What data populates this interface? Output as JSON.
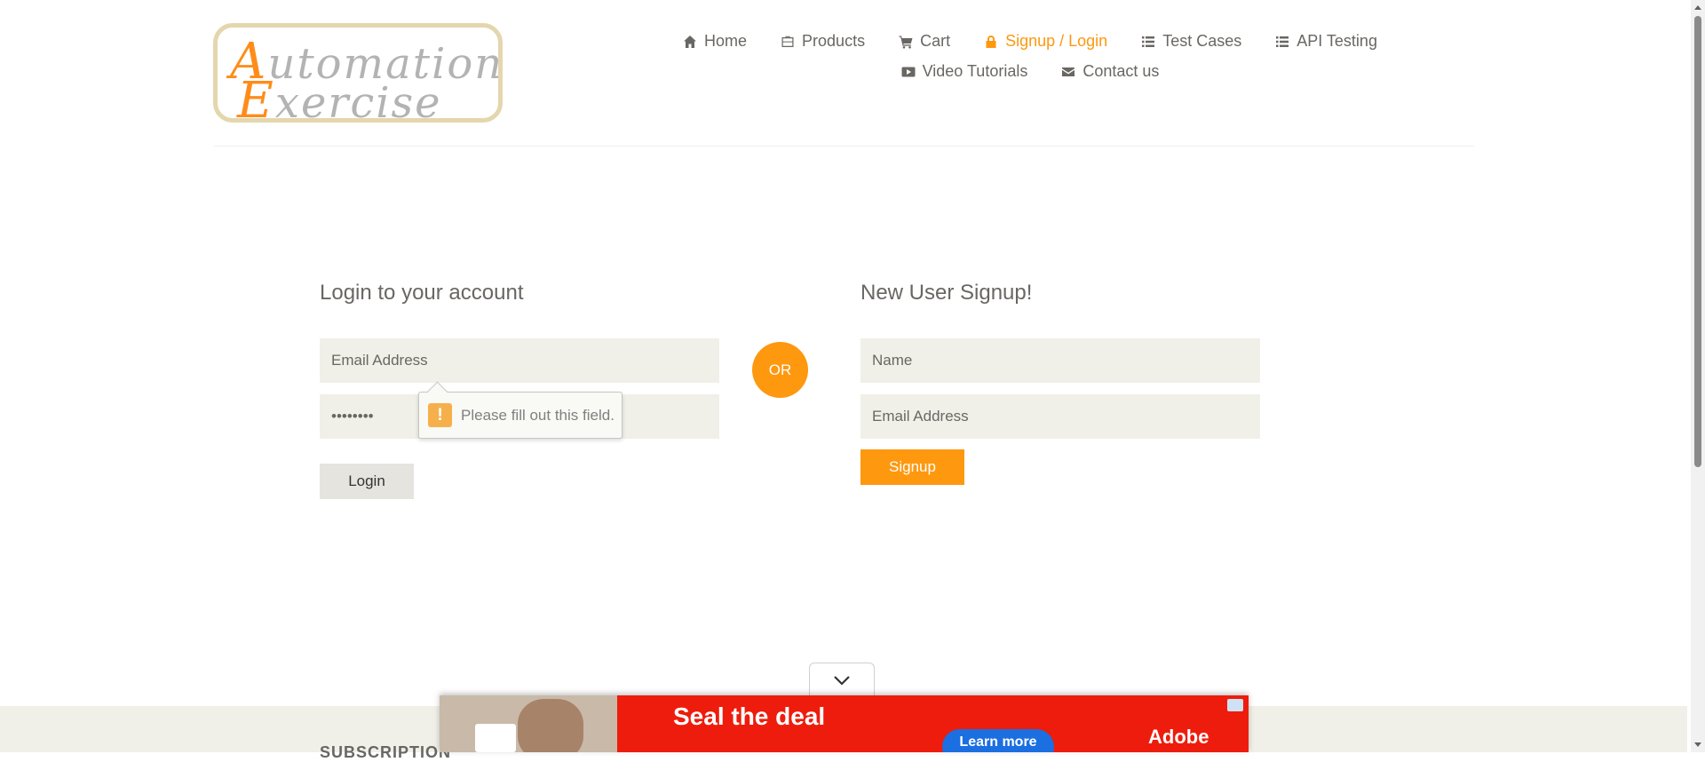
{
  "logo": {
    "line1_cap": "A",
    "line1_rest": "utomation",
    "line2_cap": "E",
    "line2_rest": "xercise"
  },
  "nav": {
    "items": [
      {
        "label": "Home",
        "icon": "home-icon"
      },
      {
        "label": "Products",
        "icon": "briefcase-icon"
      },
      {
        "label": "Cart",
        "icon": "cart-icon"
      },
      {
        "label": "Signup / Login",
        "icon": "lock-icon",
        "active": true
      },
      {
        "label": "Test Cases",
        "icon": "list-icon"
      },
      {
        "label": "API Testing",
        "icon": "list-icon"
      },
      {
        "label": "Video Tutorials",
        "icon": "youtube-icon"
      },
      {
        "label": "Contact us",
        "icon": "envelope-icon"
      }
    ],
    "active_color": "#fe980f"
  },
  "login": {
    "title": "Login to your account",
    "email_placeholder": "Email Address",
    "password_value": "password",
    "button": "Login",
    "validation_message": "Please fill out this field.",
    "validation_icon": "!"
  },
  "or_label": "OR",
  "signup": {
    "title": "New User Signup!",
    "name_placeholder": "Name",
    "email_placeholder": "Email Address",
    "button": "Signup"
  },
  "footer": {
    "subscription_title": "SUBSCRIPTION"
  },
  "ad": {
    "headline": "Seal the deal",
    "cta": "Learn more",
    "brand": "Adobe"
  },
  "colors": {
    "accent": "#fe980f",
    "field_bg": "#f0f0e9",
    "text": "#696763"
  }
}
